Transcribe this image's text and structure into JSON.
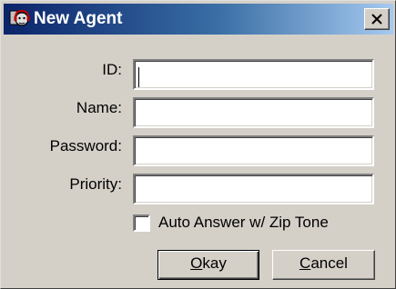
{
  "window": {
    "title": "New Agent",
    "icon": "agent-headset-icon",
    "close_icon": "close-x-icon"
  },
  "form": {
    "id_label": "ID:",
    "id_value": "",
    "name_label": "Name:",
    "name_value": "",
    "password_label": "Password:",
    "password_value": "",
    "priority_label": "Priority:",
    "priority_value": "",
    "auto_answer_label": "Auto Answer w/ Zip Tone",
    "auto_answer_checked": false
  },
  "buttons": {
    "okay_accel": "O",
    "okay_rest": "kay",
    "cancel_accel": "C",
    "cancel_rest": "ancel"
  },
  "colors": {
    "titlebar_start": "#0a246a",
    "titlebar_end": "#a6caf0",
    "face": "#d4d0c8"
  }
}
